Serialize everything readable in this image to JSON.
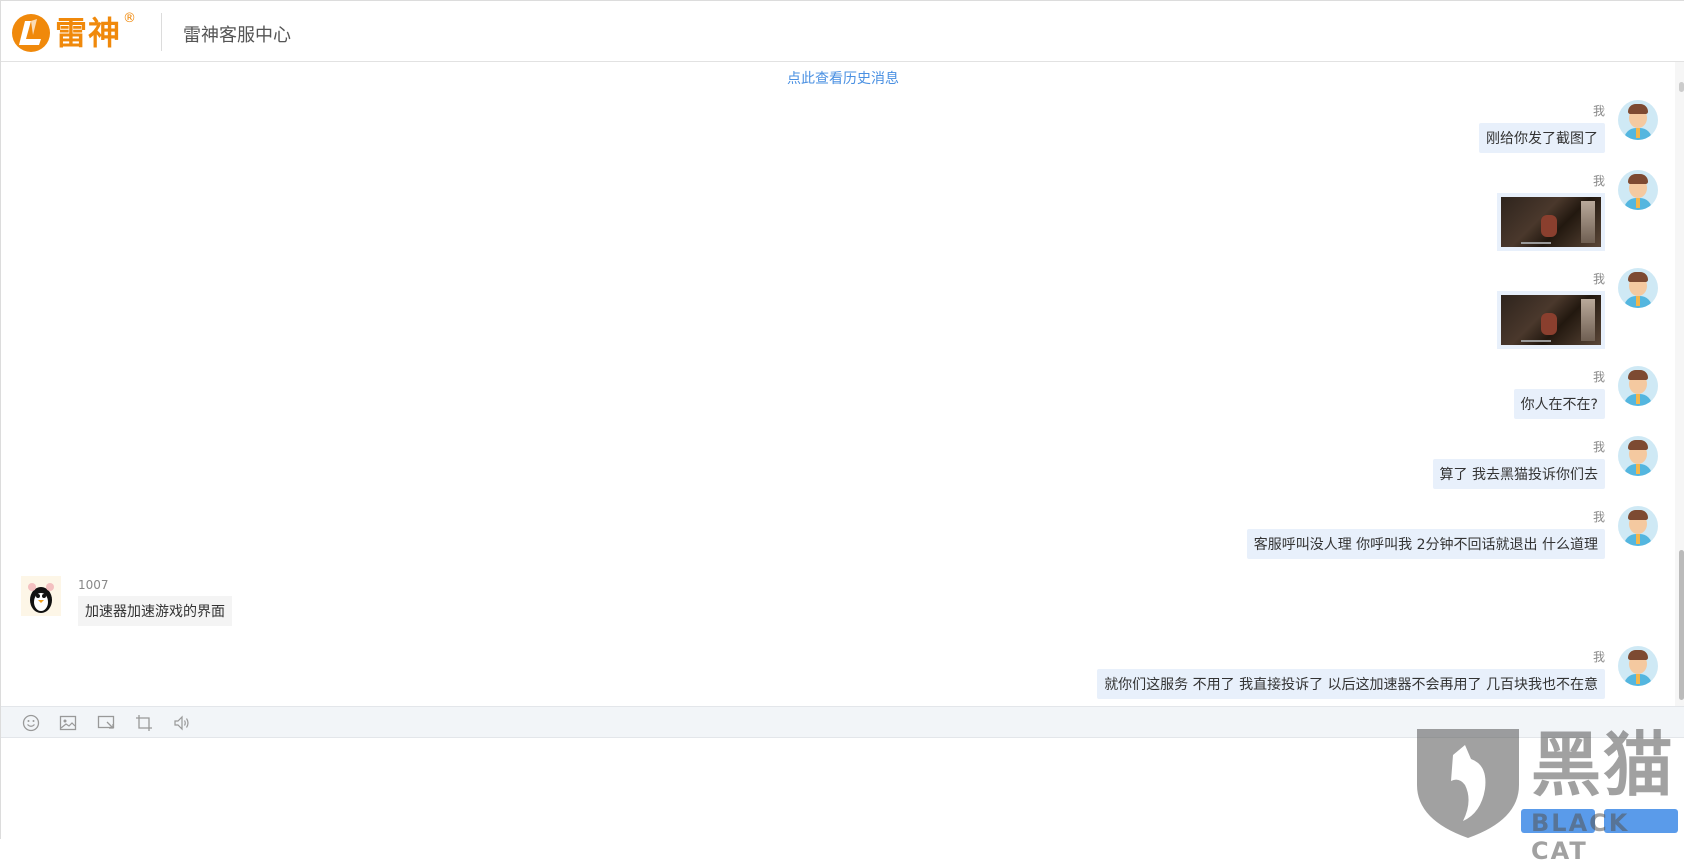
{
  "header": {
    "logo_text": "雷神",
    "logo_reg": "®",
    "title": "雷神客服中心"
  },
  "chat": {
    "history_link": "点此查看历史消息",
    "messages": [
      {
        "from": "me",
        "sender": "我",
        "type": "text",
        "text": "刚给你发了截图了"
      },
      {
        "from": "me",
        "sender": "我",
        "type": "image"
      },
      {
        "from": "me",
        "sender": "我",
        "type": "image"
      },
      {
        "from": "me",
        "sender": "我",
        "type": "text",
        "text": "你人在不在?"
      },
      {
        "from": "me",
        "sender": "我",
        "type": "text",
        "text": "算了 我去黑猫投诉你们去"
      },
      {
        "from": "me",
        "sender": "我",
        "type": "text",
        "text": "客服呼叫没人理 你呼叫我 2分钟不回话就退出 什么道理"
      },
      {
        "from": "agent",
        "sender": "1007",
        "type": "text",
        "text": "加速器加速游戏的界面"
      },
      {
        "from": "me",
        "sender": "我",
        "type": "text",
        "text": "就你们这服务 不用了 我直接投诉了 以后这加速器不会再用了 几百块我也不在意"
      }
    ]
  },
  "toolbar": {
    "icons": [
      "emoji-icon",
      "image-icon",
      "screenshot-icon",
      "crop-icon",
      "volume-icon"
    ]
  },
  "input": {
    "placeholder": "",
    "value": ""
  },
  "buttons": {
    "left": "",
    "right": ""
  },
  "watermark": {
    "cn": "黑猫",
    "en": "BLACK CAT"
  },
  "colors": {
    "brand": "#f0890b",
    "link": "#4a90e2",
    "my_bubble": "#e8f0fb",
    "agent_bubble": "#f4f4f4",
    "toolbar_bg": "#f2f5f8"
  }
}
